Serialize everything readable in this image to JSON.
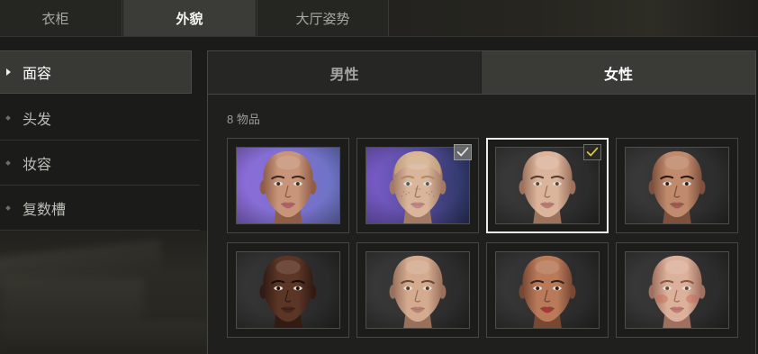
{
  "top_tabs": [
    {
      "label": "衣柜",
      "active": false
    },
    {
      "label": "外貌",
      "active": true
    },
    {
      "label": "大厅姿势",
      "active": false
    }
  ],
  "sidebar": {
    "items": [
      {
        "label": "面容",
        "active": true,
        "icon": "arrow-right-icon"
      },
      {
        "label": "头发",
        "active": false,
        "icon": "bullet-icon"
      },
      {
        "label": "妆容",
        "active": false,
        "icon": "bullet-icon"
      },
      {
        "label": "复数槽",
        "active": false,
        "icon": "bullet-icon"
      }
    ]
  },
  "gender_tabs": [
    {
      "label": "男性",
      "active": false
    },
    {
      "label": "女性",
      "active": true
    }
  ],
  "item_count_label": "8 物品",
  "colors": {
    "selected_border": "#eeeeea",
    "accent": "#e3c53a"
  },
  "faces": [
    {
      "backdrop_colors": [
        "#8d6cda",
        "#6c74c4"
      ],
      "skin": "#c8957a",
      "shade": "#8e5d47",
      "lips": "#b3646a",
      "brow": "#3e2a22",
      "iris": "#3a2a20",
      "checked": false,
      "selected": false
    },
    {
      "backdrop_colors": [
        "#7c5dcd",
        "#2d3765"
      ],
      "skin": "#d9b59c",
      "shade": "#a27a64",
      "lips": "#c18a86",
      "brow": "#b08a66",
      "iris": "#4a5c68",
      "stubble_color": "#d4b68e",
      "freckle_color": "#a26f55",
      "checked": true,
      "check_color": "#e4e4e0",
      "selected": false
    },
    {
      "backdrop_colors": [
        "#3a3a3a",
        "#2a2a2a"
      ],
      "skin": "#dbb49c",
      "shade": "#9c725d",
      "lips": "#bc7d77",
      "brow": "#5a3d30",
      "iris": "#584434",
      "checked": true,
      "check_color": "#e3c53a",
      "selected": true
    },
    {
      "backdrop_colors": [
        "#3a3a3a",
        "#2b2b2b"
      ],
      "skin": "#c08a6c",
      "shade": "#7d513d",
      "lips": "#a35d54",
      "brow": "#2a1a14",
      "iris": "#2a1c14",
      "checked": false,
      "selected": false
    },
    {
      "backdrop_colors": [
        "#363636",
        "#282828"
      ],
      "skin": "#5b3526",
      "shade": "#321b12",
      "lips": "#48251c",
      "brow": "#190e0a",
      "iris": "#130a07",
      "checked": false,
      "selected": false
    },
    {
      "backdrop_colors": [
        "#393939",
        "#2a2a2a"
      ],
      "skin": "#d5ab90",
      "shade": "#98705b",
      "lips": "#b78175",
      "brow": "#6b4a3a",
      "iris": "#4a3b30",
      "checked": false,
      "selected": false
    },
    {
      "backdrop_colors": [
        "#373737",
        "#292929"
      ],
      "skin": "#b97a5a",
      "shade": "#784833",
      "lips": "#a73935",
      "brow": "#3a2418",
      "iris": "#2b1b13",
      "checked": false,
      "selected": false
    },
    {
      "backdrop_colors": [
        "#393939",
        "#2a2a2a"
      ],
      "skin": "#dcb19b",
      "shade": "#9f6f5f",
      "lips": "#c27a72",
      "brow": "#8a5a44",
      "iris": "#5b4a3c",
      "blush_color": "#cf6557",
      "checked": false,
      "selected": false
    }
  ]
}
